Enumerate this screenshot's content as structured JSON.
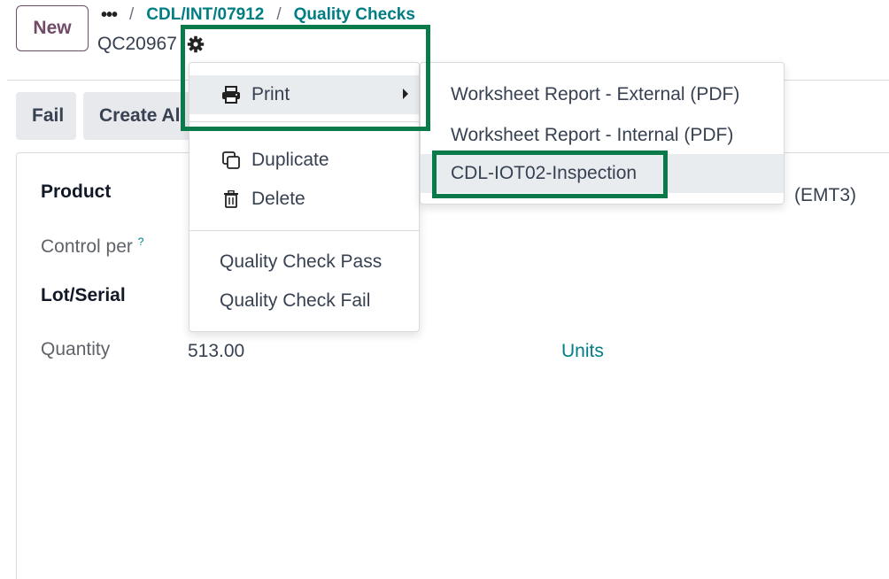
{
  "control_panel": {
    "new_button": "New",
    "breadcrumb_more": "•••",
    "breadcrumb_sep": "/",
    "breadcrumb_items": [
      "CDL/INT/07912",
      "Quality Checks"
    ],
    "record_name": "QC20967"
  },
  "statusbar": {
    "buttons": [
      "Fail",
      "Create Al"
    ]
  },
  "form": {
    "fields": [
      {
        "label": "Product",
        "value": "(EMT3)"
      },
      {
        "label": "Control per",
        "help": "?"
      },
      {
        "label": "Lot/Serial"
      },
      {
        "label": "Quantity",
        "value": "513.00",
        "uom": "Units"
      }
    ]
  },
  "gear_menu": {
    "items": [
      {
        "label": "Print",
        "icon": "printer-icon"
      },
      {
        "label": "Duplicate",
        "icon": "copy-icon"
      },
      {
        "label": "Delete",
        "icon": "trash-icon"
      },
      {
        "label": "Quality Check Pass"
      },
      {
        "label": "Quality Check Fail"
      }
    ]
  },
  "print_submenu": {
    "items": [
      "Worksheet Report - External (PDF)",
      "Worksheet Report - Internal (PDF)",
      "CDL-IOT02-Inspection"
    ]
  },
  "colors": {
    "brand": "#714b67",
    "link": "#017e84",
    "highlight": "#0b7a4b"
  }
}
